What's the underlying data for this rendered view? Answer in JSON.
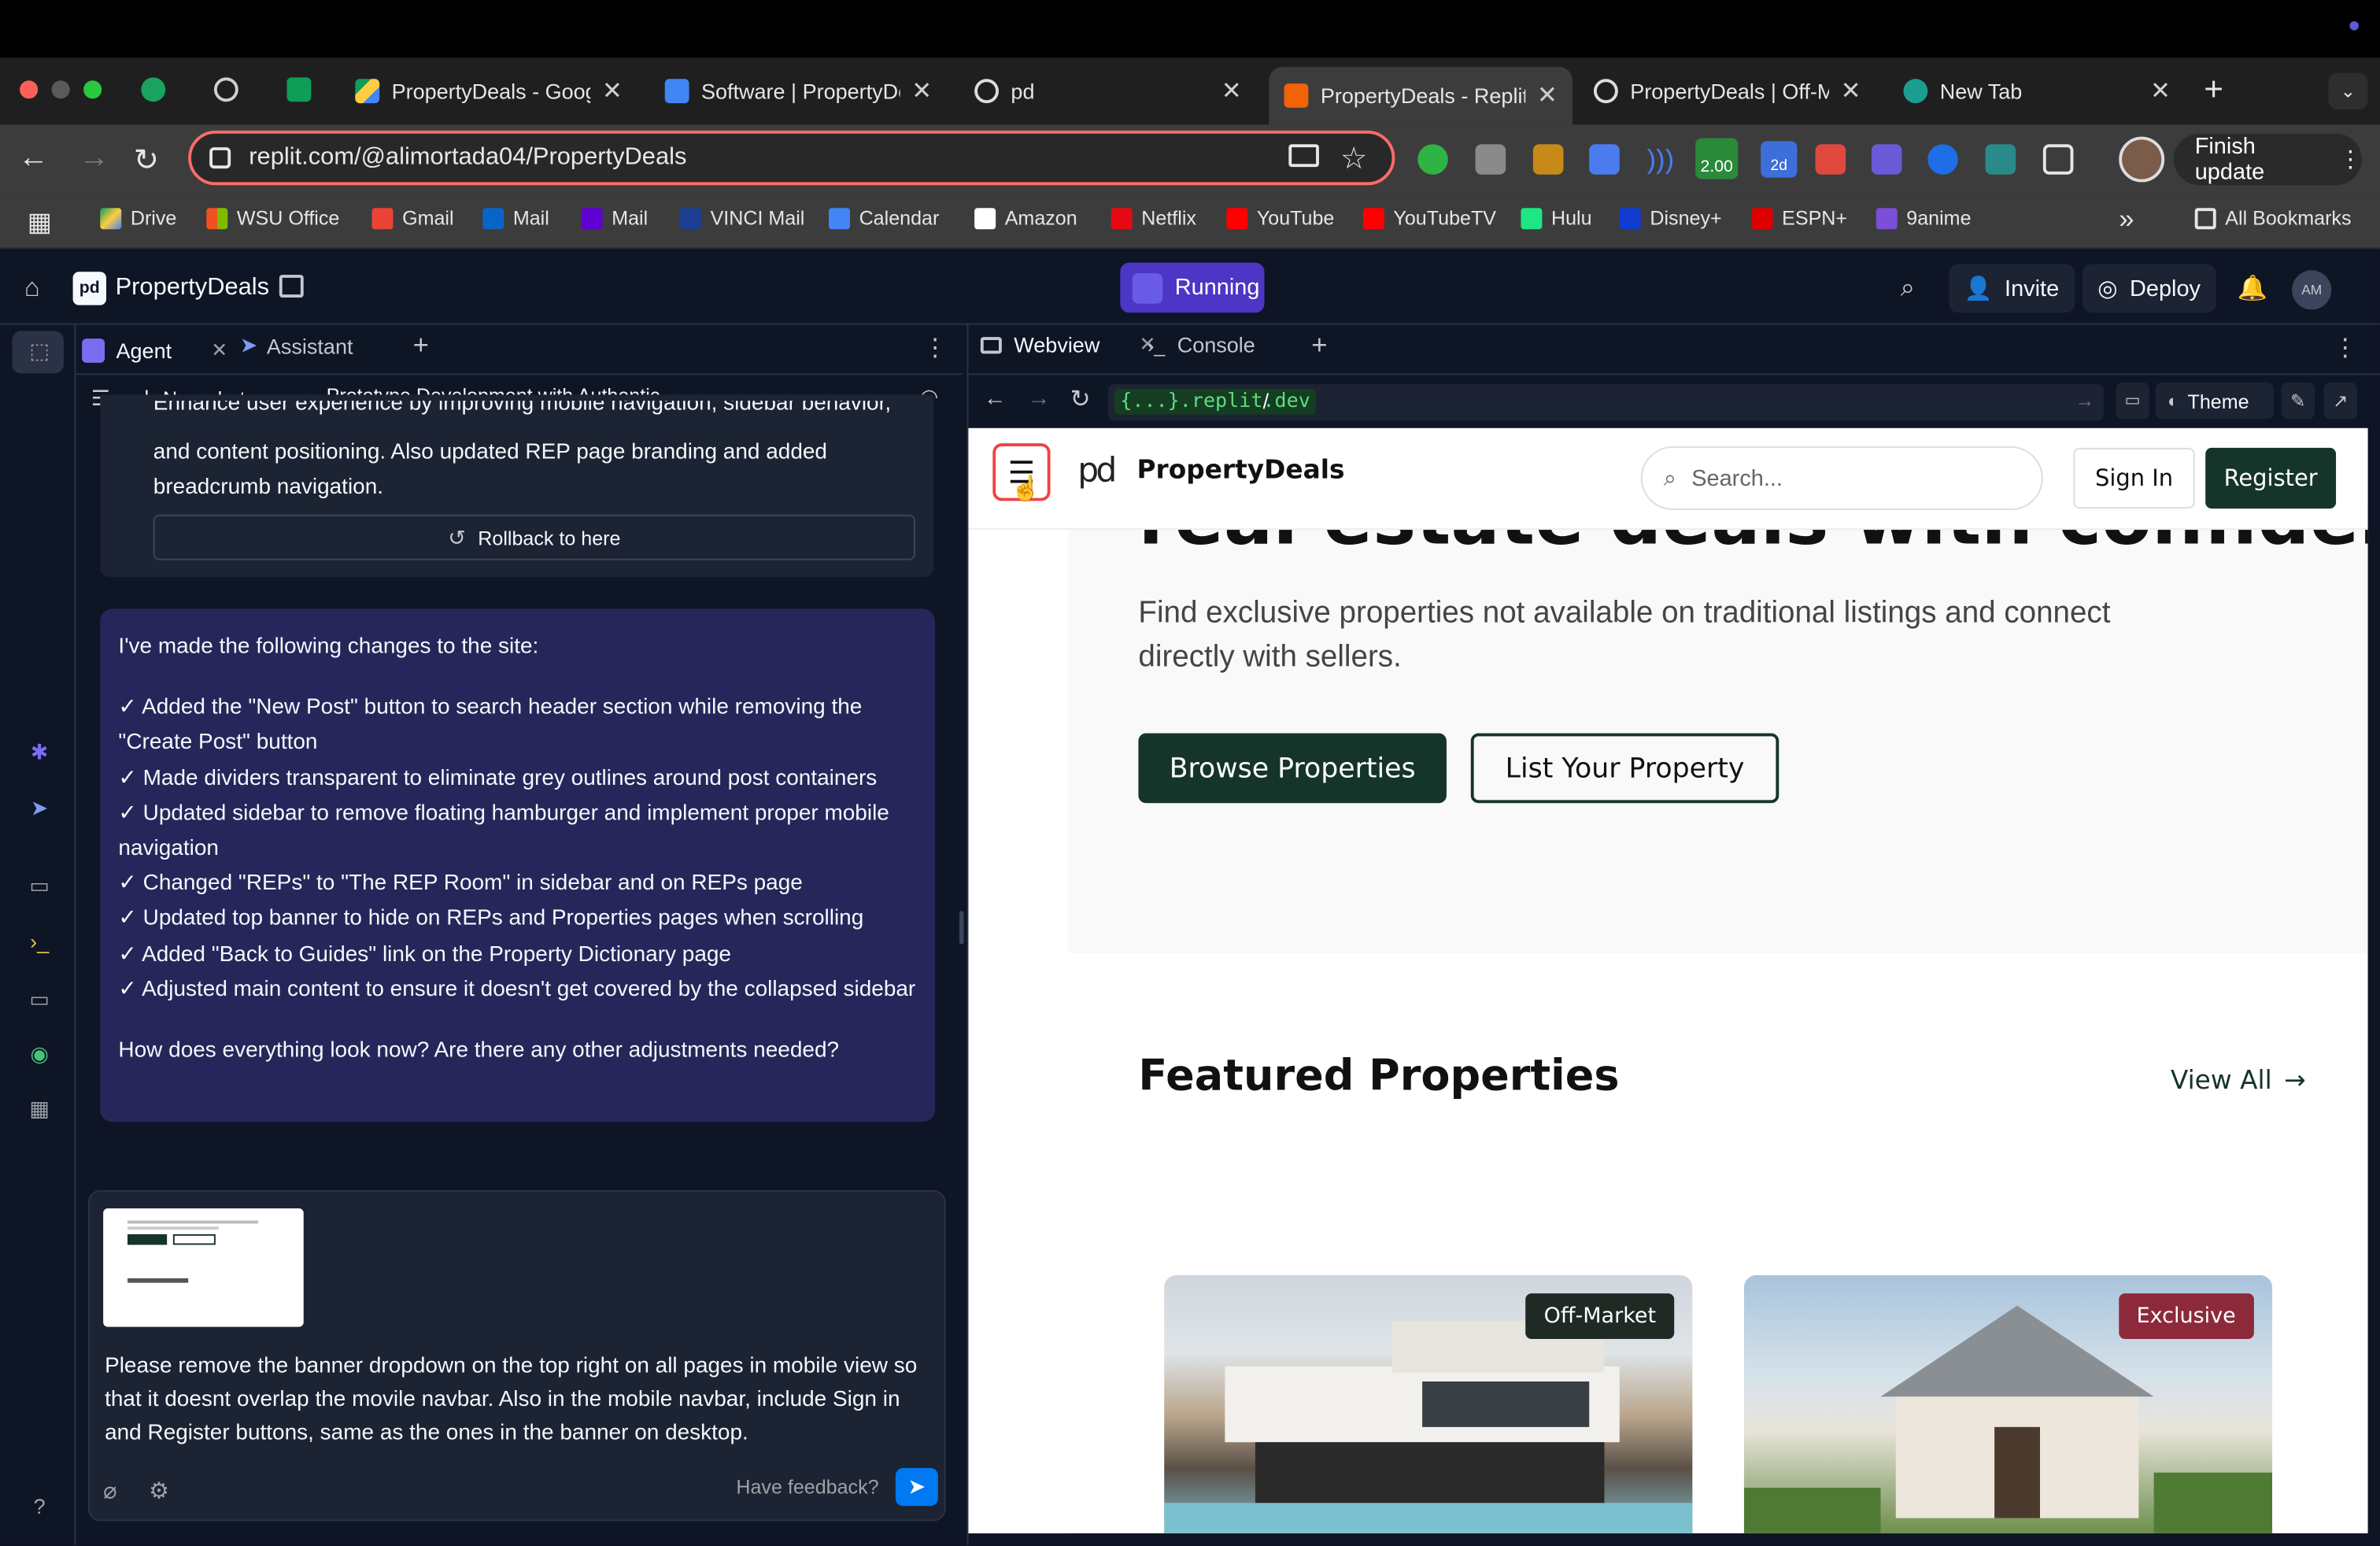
{
  "browser": {
    "tabs": [
      {
        "label": "PropertyDeals - Googl",
        "icon": "google-drive-icon"
      },
      {
        "label": "Software | PropertyDe",
        "icon": "google-docs-icon"
      },
      {
        "label": "pd",
        "icon": "openai-icon"
      },
      {
        "label": "PropertyDeals - Replit",
        "icon": "replit-icon",
        "active": true
      },
      {
        "label": "PropertyDeals | Off-M",
        "icon": "globe-icon"
      },
      {
        "label": "New Tab",
        "icon": "meet-icon"
      }
    ],
    "url": "replit.com/@alimortada04/PropertyDeals",
    "finish_update": "Finish update",
    "ext_badge": "2.00",
    "ext_badge2": "2d",
    "bookmarks": [
      "Drive",
      "WSU Office",
      "Gmail",
      "Mail",
      "Mail",
      "VINCI Mail",
      "Calendar",
      "Amazon",
      "Netflix",
      "YouTube",
      "YouTubeTV",
      "Hulu",
      "Disney+",
      "ESPN+",
      "9anime"
    ],
    "all_bookmarks": "All Bookmarks"
  },
  "replit": {
    "project": "PropertyDeals",
    "running": "Running",
    "invite": "Invite",
    "deploy": "Deploy",
    "avatar": "AM",
    "tabs": {
      "agent": "Agent",
      "assistant": "Assistant"
    },
    "new_chat": "New chat",
    "chat_title": "Prototype Development with Authentic...",
    "prev_msg": [
      "Enhance user experience by improving mobile navigation, sidebar behavior,",
      "and content positioning. Also updated REP page branding and added",
      "breadcrumb navigation."
    ],
    "rollback": "Rollback to here",
    "agent_msg": {
      "intro": "I've made the following changes to the site:",
      "items": [
        "✓ Added the \"New Post\" button to search header section while removing the \"Create Post\" button",
        "✓ Made dividers transparent to eliminate grey outlines around post containers",
        "✓ Updated sidebar to remove floating hamburger and implement proper mobile navigation",
        "✓ Changed \"REPs\" to \"The REP Room\" in sidebar and on REPs page",
        "✓ Updated top banner to hide on REPs and Properties pages when scrolling",
        "✓ Added \"Back to Guides\" link on the Property Dictionary page",
        "✓ Adjusted main content to ensure it doesn't get covered by the collapsed sidebar"
      ],
      "outro": "How does everything look now? Are there any other adjustments needed?"
    },
    "composer": {
      "text": "Please remove the banner dropdown on the top right on all pages in mobile view so that it doesnt overlap the movile navbar. Also in the mobile navbar, include Sign in and Register buttons, same as the ones in the banner on desktop.",
      "feedback": "Have feedback?"
    },
    "webview": {
      "tab": "Webview",
      "console": "Console",
      "domain": "{...}.replit.dev",
      "path": "/",
      "theme": "Theme"
    }
  },
  "site": {
    "brand": "PropertyDeals",
    "search_placeholder": "Search...",
    "sign_in": "Sign In",
    "register": "Register",
    "hero_partial": "real estate deals with confidence.",
    "hero_sub": "Find exclusive properties not available on traditional listings and connect directly with sellers.",
    "browse": "Browse Properties",
    "list": "List Your Property",
    "featured": "Featured Properties",
    "view_all": "View All",
    "cards": [
      {
        "badge": "Off-Market",
        "badge_color": "#1f2a24"
      },
      {
        "badge": "Exclusive",
        "badge_color": "#8c2a3c"
      }
    ]
  }
}
